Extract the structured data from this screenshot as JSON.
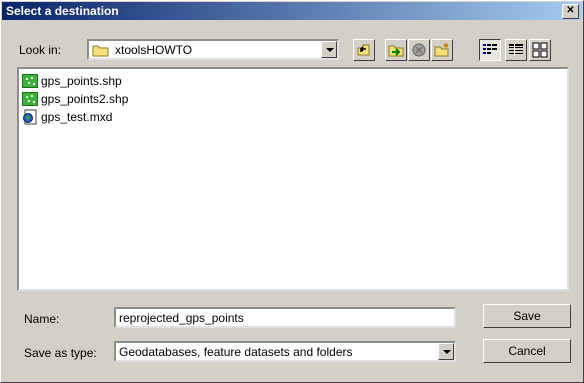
{
  "dialog": {
    "title": "Select a destination"
  },
  "look_in": {
    "label": "Look in:",
    "value": "xtoolsHOWTO"
  },
  "toolbar": {
    "up_icon": "up-one-level-icon",
    "connect_icon": "connect-folder-icon",
    "disconnect_icon": "disconnect-folder-icon",
    "new_folder_icon": "new-folder-icon",
    "list_icon": "list-view-icon",
    "details_icon": "details-view-icon",
    "thumbnails_icon": "thumbnails-view-icon"
  },
  "files": [
    {
      "name": "gps_points.shp",
      "icon": "shapefile-icon"
    },
    {
      "name": "gps_points2.shp",
      "icon": "shapefile-icon"
    },
    {
      "name": "gps_test.mxd",
      "icon": "map-document-icon"
    }
  ],
  "name_field": {
    "label": "Name:",
    "value": "reprojected_gps_points"
  },
  "save_type": {
    "label": "Save as type:",
    "value": "Geodatabases, feature datasets and folders"
  },
  "buttons": {
    "save": "Save",
    "cancel": "Cancel"
  }
}
